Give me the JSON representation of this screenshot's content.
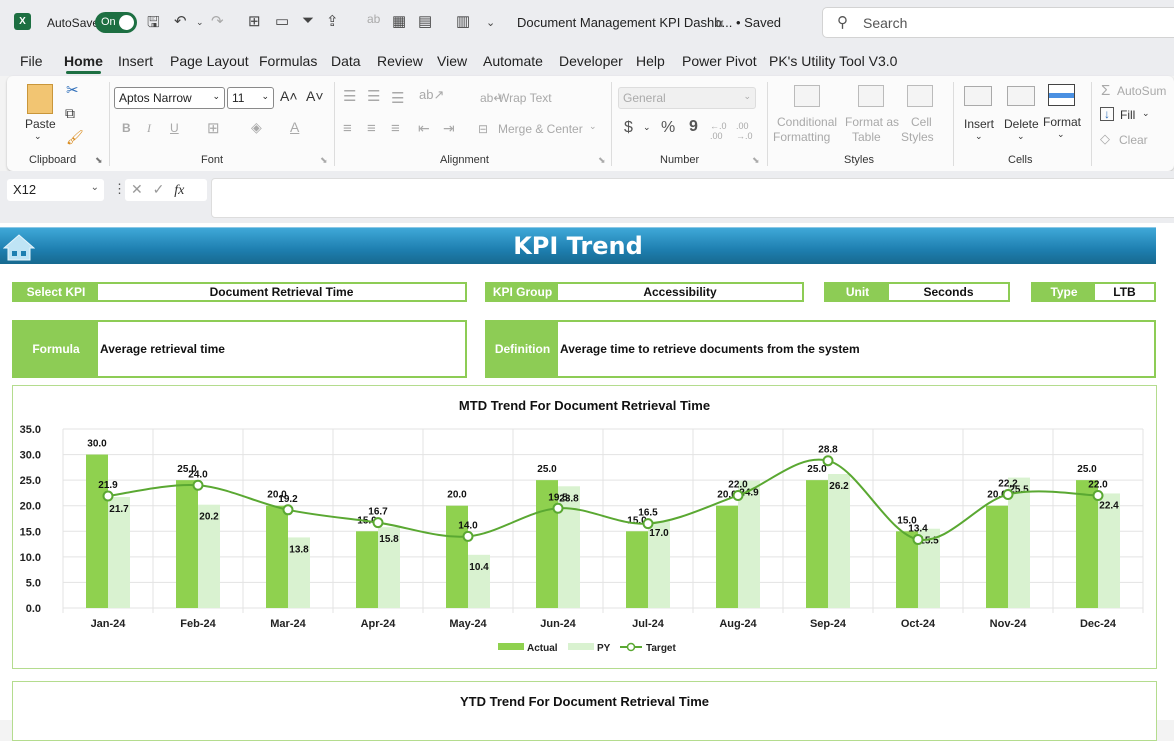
{
  "titlebar": {
    "app_icon": "excel-logo-icon",
    "autosave_label": "AutoSave",
    "autosave_state": "On",
    "doc_title": "Document Management KPI Dashb...",
    "save_status": "• Saved",
    "search_placeholder": "Search"
  },
  "menu": {
    "tabs": [
      "File",
      "Home",
      "Insert",
      "Page Layout",
      "Formulas",
      "Data",
      "Review",
      "View",
      "Automate",
      "Developer",
      "Help",
      "Power Pivot",
      "PK's Utility Tool V3.0"
    ],
    "active": "Home"
  },
  "ribbon": {
    "clipboard": {
      "paste": "Paste",
      "group": "Clipboard"
    },
    "font": {
      "name": "Aptos Narrow",
      "size": "11",
      "group": "Font",
      "bold": "B",
      "italic": "I",
      "underline": "U"
    },
    "alignment": {
      "wrap_text": "Wrap Text",
      "merge_center": "Merge & Center",
      "group": "Alignment"
    },
    "number": {
      "format": "General",
      "currency": "$",
      "percent": "%",
      "comma": "9",
      "group": "Number"
    },
    "styles": {
      "conditional": "Conditional",
      "conditional2": "Formatting",
      "format_table": "Format as",
      "format_table2": "Table",
      "cell_styles": "Cell",
      "cell_styles2": "Styles",
      "group": "Styles"
    },
    "cells": {
      "insert": "Insert",
      "delete": "Delete",
      "format": "Format",
      "group": "Cells"
    },
    "editing": {
      "autosum": "AutoSum",
      "fill": "Fill",
      "clear": "Clear"
    }
  },
  "formula_bar": {
    "name_box": "X12",
    "fx": "fx",
    "value": ""
  },
  "dashboard": {
    "title": "KPI Trend",
    "select_kpi_label": "Select KPI",
    "select_kpi_value": "Document Retrieval Time",
    "kpi_group_label": "KPI Group",
    "kpi_group_value": "Accessibility",
    "unit_label": "Unit",
    "unit_value": "Seconds",
    "type_label": "Type",
    "type_value": "LTB",
    "formula_label": "Formula",
    "formula_value": "Average retrieval time",
    "definition_label": "Definition",
    "definition_value": "Average time to retrieve documents from the system",
    "ytd_title": "YTD Trend For Document Retrieval Time"
  },
  "colors": {
    "accent_green": "#8dcc55",
    "actual": "#8fd14f",
    "py": "#d9f2d0",
    "target": "#5aa832",
    "banner": "#1e7fb0"
  },
  "chart_data": {
    "type": "bar",
    "title": "MTD Trend For Document Retrieval Time",
    "categories": [
      "Jan-24",
      "Feb-24",
      "Mar-24",
      "Apr-24",
      "May-24",
      "Jun-24",
      "Jul-24",
      "Aug-24",
      "Sep-24",
      "Oct-24",
      "Nov-24",
      "Dec-24"
    ],
    "series": [
      {
        "name": "Actual",
        "kind": "bar",
        "values": [
          30.0,
          25.0,
          20.0,
          15.0,
          20.0,
          25.0,
          15.0,
          20.0,
          25.0,
          15.0,
          20.0,
          25.0
        ]
      },
      {
        "name": "PY",
        "kind": "bar",
        "values": [
          21.7,
          20.2,
          13.8,
          15.8,
          10.4,
          23.8,
          17.0,
          24.9,
          26.2,
          15.5,
          25.5,
          22.4
        ]
      },
      {
        "name": "Target",
        "kind": "line",
        "values": [
          21.9,
          24.0,
          19.2,
          16.7,
          14.0,
          19.5,
          16.5,
          22.0,
          28.8,
          13.4,
          22.2,
          22.0
        ]
      }
    ],
    "y_ticks": [
      "0.0",
      "5.0",
      "10.0",
      "15.0",
      "20.0",
      "25.0",
      "30.0",
      "35.0"
    ],
    "ylim": [
      0,
      35
    ],
    "grid": true,
    "legend": "bottom",
    "xlabel": "",
    "ylabel": ""
  }
}
